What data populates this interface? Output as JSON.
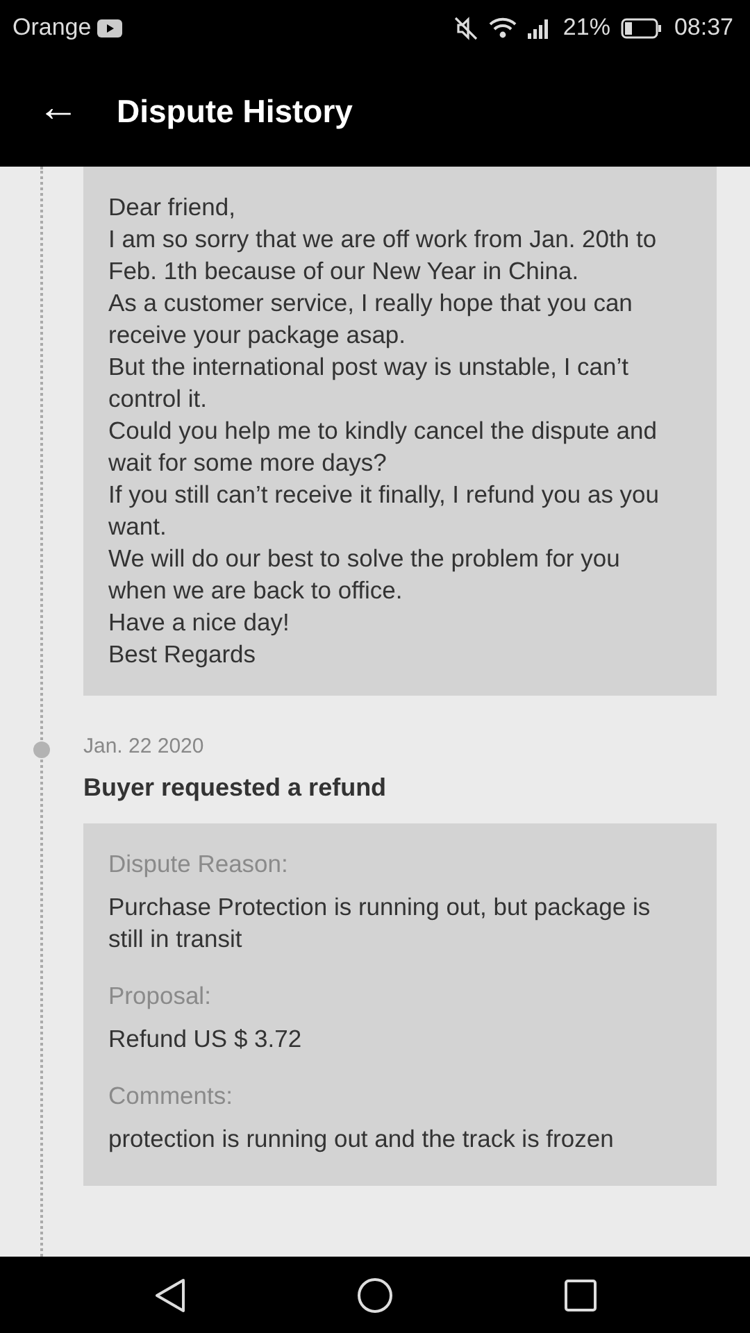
{
  "status_bar": {
    "carrier": "Orange",
    "battery": "21%",
    "time": "08:37"
  },
  "header": {
    "back": "←",
    "title": "Dispute History"
  },
  "events": [
    {
      "sections": [
        {
          "kind": "message",
          "paragraphs": [
            "Dear friend,",
            "I am so sorry that we are off work from Jan. 20th to Feb. 1th because of our New Year in China.",
            "As a customer service, I really hope that you can receive your package asap.",
            "But the international post way is unstable, I can’t control it.",
            "Could you help me to kindly cancel the dispute and wait for some more days?",
            "If you still can’t receive it finally, I refund you as you want.",
            "We will do our best to solve the problem for you when we are back to office.",
            "Have a nice day!",
            "Best Regards"
          ]
        }
      ]
    },
    {
      "date": "Jan. 22 2020",
      "title": "Buyer requested a refund",
      "sections": [
        {
          "kind": "field",
          "label": "Dispute Reason:",
          "value": "Purchase Protection is running out, but package is still in transit"
        },
        {
          "kind": "field",
          "label": "Proposal:",
          "value": "Refund US $ 3.72"
        },
        {
          "kind": "field",
          "label": "Comments:",
          "value": "protection is running out and the track is frozen"
        }
      ]
    }
  ]
}
